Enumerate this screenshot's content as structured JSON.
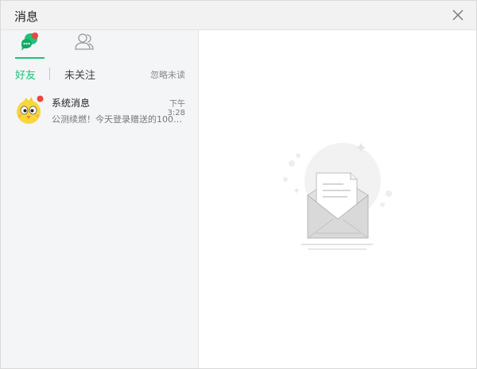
{
  "window": {
    "title": "消息"
  },
  "tabs": [
    {
      "name": "messages",
      "icon": "chat-bubbles-icon",
      "active": true,
      "has_dot": true
    },
    {
      "name": "contacts",
      "icon": "people-icon",
      "active": false
    }
  ],
  "filters": {
    "friends_label": "好友",
    "not_followed_label": "未关注",
    "ignore_unread_label": "忽略未读"
  },
  "conversations": [
    {
      "name": "系统消息",
      "time": "下午3:28",
      "preview": "公测续燃！今天登录赠送的1000...",
      "avatar_icon": "cartoon-chick-icon",
      "unread": true
    }
  ],
  "colors": {
    "accent": "#1fc27a",
    "badge": "#f0443b",
    "sidebar_bg": "#f4f5f7",
    "titlebar_bg": "#f2f2f2"
  }
}
